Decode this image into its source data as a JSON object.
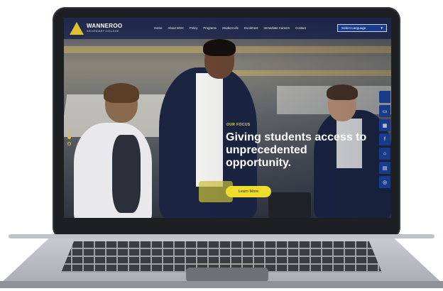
{
  "brand": {
    "name": "WANNEROO",
    "subtitle": "SECONDARY COLLEGE"
  },
  "nav": {
    "items": [
      "Home",
      "About WSC",
      "Policy",
      "Programs",
      "Student Life",
      "Enrolment",
      "Immediate Careers",
      "Contact"
    ],
    "language_select": "Select Language"
  },
  "hero": {
    "kicker": "OUR FOCUS",
    "headline": "Giving students access to unprecedented opportunity.",
    "cta_label": "Learn More",
    "slides": 3,
    "active_slide": 1
  },
  "side_icons": [
    "apple-icon",
    "monitor-icon",
    "calendar-icon",
    "facebook-icon",
    "home-icon",
    "calendar-alt-icon",
    "instagram-icon"
  ],
  "colors": {
    "accent": "#e1c12b",
    "nav": "#1a3a8a",
    "cta": "#eedc2a"
  }
}
